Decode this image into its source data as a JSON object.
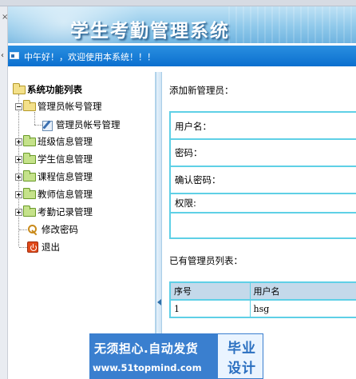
{
  "banner": {
    "title": "学生考勤管理系统"
  },
  "welcome": {
    "text": "中午好！，欢迎使用本系统！！！"
  },
  "sidebar": {
    "root": "系统功能列表",
    "groups": [
      {
        "label": "管理员帐号管理",
        "expanded": true,
        "children": [
          {
            "label": "管理员帐号管理"
          }
        ]
      },
      {
        "label": "班级信息管理",
        "expanded": false
      },
      {
        "label": "学生信息管理",
        "expanded": false
      },
      {
        "label": "课程信息管理",
        "expanded": false
      },
      {
        "label": "教师信息管理",
        "expanded": false
      },
      {
        "label": "考勤记录管理",
        "expanded": false
      }
    ],
    "change_password": "修改密码",
    "logout": "退出"
  },
  "form": {
    "title": "添加新管理员：",
    "username_label": "用户名：",
    "password_label": "密码：",
    "confirm_password_label": "确认密码：",
    "permission_label": "权限:"
  },
  "list": {
    "title": "已有管理员列表：",
    "columns": [
      "序号",
      "用户名"
    ],
    "rows": [
      [
        "1",
        "hsg"
      ]
    ]
  },
  "watermark": {
    "line1": "无须担心.自动发货",
    "line2": "www.51topmind.com",
    "line3": "毕业",
    "line4": "设计"
  },
  "colors": {
    "welcome_bar": "#0b6fcf",
    "form_border": "#5fd0e6",
    "table_header": "#c4d9ea",
    "watermark_blue": "#3a7fcf"
  }
}
